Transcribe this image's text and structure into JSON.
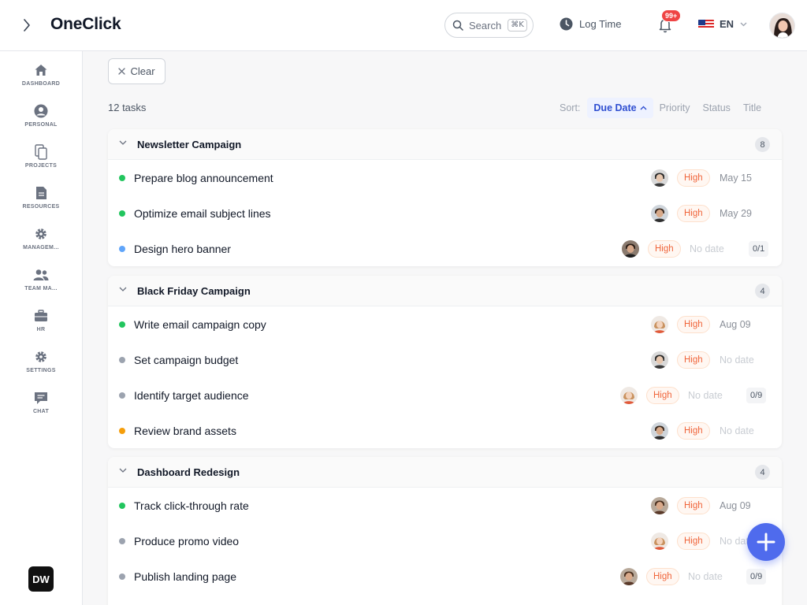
{
  "header": {
    "app_title": "OneClick",
    "search_label": "Search",
    "search_kbd": "⌘K",
    "log_time_label": "Log Time",
    "notification_count": "99+",
    "language": "EN"
  },
  "sidebar": {
    "items": [
      {
        "label": "DASHBOARD",
        "icon": "home-icon"
      },
      {
        "label": "PERSONAL",
        "icon": "user-icon"
      },
      {
        "label": "PROJECTS",
        "icon": "copy-icon"
      },
      {
        "label": "RESOURCES",
        "icon": "document-icon"
      },
      {
        "label": "MANAGEM...",
        "icon": "gear-icon"
      },
      {
        "label": "TEAM MA...",
        "icon": "team-icon"
      },
      {
        "label": "HR",
        "icon": "briefcase-icon"
      },
      {
        "label": "SETTINGS",
        "icon": "gear-icon"
      },
      {
        "label": "CHAT",
        "icon": "chat-icon"
      }
    ],
    "user_initials": "DW"
  },
  "toolbar": {
    "clear_label": "Clear",
    "task_count": "12 tasks",
    "sort_label": "Sort:",
    "sort_options": [
      "Due Date",
      "Priority",
      "Status",
      "Title"
    ],
    "active_sort": "Due Date"
  },
  "colors": {
    "accent": "#4f6bed",
    "status_green": "#22c55e",
    "status_blue": "#60a5fa",
    "status_gray": "#9ca3af",
    "status_orange": "#f59e0b",
    "priority_high": "#f0653b"
  },
  "groups": [
    {
      "title": "Newsletter Campaign",
      "count": "8",
      "tasks": [
        {
          "title": "Prepare blog announcement",
          "status": "green",
          "priority": "High",
          "due": "May 15",
          "subtasks": ""
        },
        {
          "title": "Optimize email subject lines",
          "status": "green",
          "priority": "High",
          "due": "May 29",
          "subtasks": ""
        },
        {
          "title": "Design hero banner",
          "status": "blue",
          "priority": "High",
          "due": "No date",
          "subtasks": "0/1"
        }
      ]
    },
    {
      "title": "Black Friday Campaign",
      "count": "4",
      "tasks": [
        {
          "title": "Write email campaign copy",
          "status": "green",
          "priority": "High",
          "due": "Aug 09",
          "subtasks": ""
        },
        {
          "title": "Set campaign budget",
          "status": "gray",
          "priority": "High",
          "due": "No date",
          "subtasks": ""
        },
        {
          "title": "Identify target audience",
          "status": "gray",
          "priority": "High",
          "due": "No date",
          "subtasks": "0/9"
        },
        {
          "title": "Review brand assets",
          "status": "orange",
          "priority": "High",
          "due": "No date",
          "subtasks": ""
        }
      ]
    },
    {
      "title": "Dashboard Redesign",
      "count": "4",
      "tasks": [
        {
          "title": "Track click-through rate",
          "status": "green",
          "priority": "High",
          "due": "Aug 09",
          "subtasks": ""
        },
        {
          "title": "Produce promo video",
          "status": "gray",
          "priority": "High",
          "due": "No date",
          "subtasks": ""
        },
        {
          "title": "Publish landing page",
          "status": "gray",
          "priority": "High",
          "due": "No date",
          "subtasks": "0/9"
        }
      ]
    }
  ]
}
